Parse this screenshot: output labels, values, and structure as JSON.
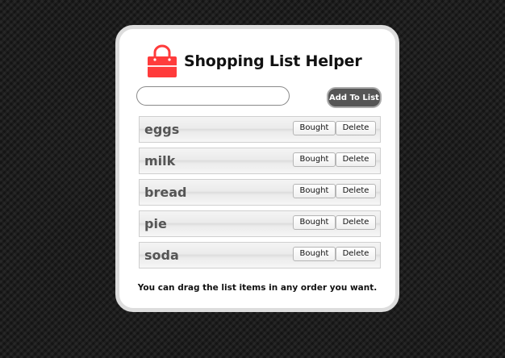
{
  "header": {
    "title": "Shopping List Helper",
    "icon": "shopping-bag-icon",
    "icon_color": "#ff3b3b"
  },
  "input": {
    "value": "",
    "placeholder": ""
  },
  "add_button": {
    "label": "Add To List"
  },
  "list": {
    "items": [
      {
        "label": "eggs",
        "bought_label": "Bought",
        "delete_label": "Delete"
      },
      {
        "label": "milk",
        "bought_label": "Bought",
        "delete_label": "Delete"
      },
      {
        "label": "bread",
        "bought_label": "Bought",
        "delete_label": "Delete"
      },
      {
        "label": "pie",
        "bought_label": "Bought",
        "delete_label": "Delete"
      },
      {
        "label": "soda",
        "bought_label": "Bought",
        "delete_label": "Delete"
      }
    ]
  },
  "footer": {
    "hint": "You can drag the list items in any order you want."
  }
}
